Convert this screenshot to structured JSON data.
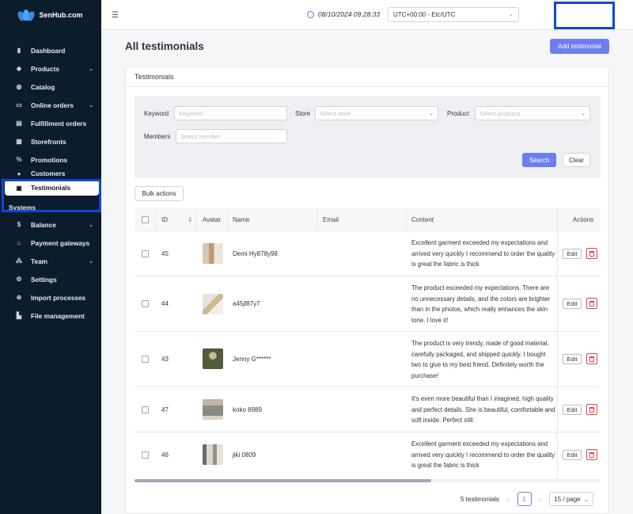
{
  "app": {
    "brand": "SenHub.com",
    "brand_color": "#4aa3ff"
  },
  "sidebar": {
    "items": [
      {
        "label": "Dashboard",
        "icon": "bar-chart-icon"
      },
      {
        "label": "Products",
        "icon": "box-icon",
        "chevron": "⌄"
      },
      {
        "label": "Catalog",
        "icon": "catalog-icon"
      },
      {
        "label": "Online orders",
        "icon": "monitor-icon",
        "chevron": "⌄"
      },
      {
        "label": "Fulfillment orders",
        "icon": "truck-icon"
      },
      {
        "label": "Storefronts",
        "icon": "storefront-icon"
      },
      {
        "label": "Promotions",
        "icon": "percent-icon"
      },
      {
        "label": "Customers",
        "icon": "users-icon"
      },
      {
        "label": "Testimonials",
        "icon": "testimonial-icon"
      }
    ],
    "section_label": "Systems",
    "system_items": [
      {
        "label": "Balance",
        "icon": "dollar-icon",
        "chevron": "⌄"
      },
      {
        "label": "Payment gateways",
        "icon": "bank-icon"
      },
      {
        "label": "Team",
        "icon": "team-icon",
        "chevron": "⌄"
      },
      {
        "label": "Settings",
        "icon": "gear-icon"
      },
      {
        "label": "Import processes",
        "icon": "import-icon"
      },
      {
        "label": "File management",
        "icon": "folder-icon"
      }
    ]
  },
  "topbar": {
    "datetime": "08/10/2024 09:28:33",
    "timezone": "UTC+00:00 - Etc/UTC"
  },
  "page": {
    "title": "All testimonials",
    "add_button": "Add testimonial",
    "accent_color": "#6d7ff0"
  },
  "card": {
    "title": "Testimonials"
  },
  "filters": {
    "keyword_label": "Keyword",
    "keyword_placeholder": "Keyword",
    "store_label": "Store",
    "store_placeholder": "Select store",
    "product_label": "Product",
    "product_placeholder": "Select products",
    "members_label": "Members",
    "members_placeholder": "Select member",
    "search_button": "Search",
    "clear_button": "Clear"
  },
  "bulk_actions": "Bulk actions",
  "table": {
    "headers": {
      "id": "ID",
      "avatar": "Avatar",
      "name": "Name",
      "email": "Email",
      "content": "Content",
      "actions": "Actions"
    },
    "edit_label": "Edit",
    "rows": [
      {
        "id": "45",
        "name": "Demi Hy878y98",
        "email": "",
        "content": "Excellent garment exceeded my expectations and arrived very quickly I recommend to order the quality is great the fabric is thick"
      },
      {
        "id": "44",
        "name": "a45jf87y7",
        "email": "",
        "content": "The product exceeded my expectations. There are no unnecessary details, and the colors are brighter than in the photos, which really enhances the skin tone. I love it!"
      },
      {
        "id": "43",
        "name": "Jenny G******",
        "email": "",
        "content": "The product is very trendy, made of good material, carefully packaged, and shipped quickly. I bought two to give to my best friend. Definitely worth the purchase!"
      },
      {
        "id": "47",
        "name": "koko 8989",
        "email": "",
        "content": "It's even more beautiful than I imagined, high quality and perfect details. She is beautiful, comfortable and soft inside. Perfect still."
      },
      {
        "id": "46",
        "name": "jiki 0809",
        "email": "",
        "content": "Excellent garment exceeded my expectations and arrived very quickly I recommend to order the quality is great the fabric is thick"
      }
    ]
  },
  "pagination": {
    "total": "5 testimonials",
    "current": "1",
    "page_size": "15 / page"
  }
}
